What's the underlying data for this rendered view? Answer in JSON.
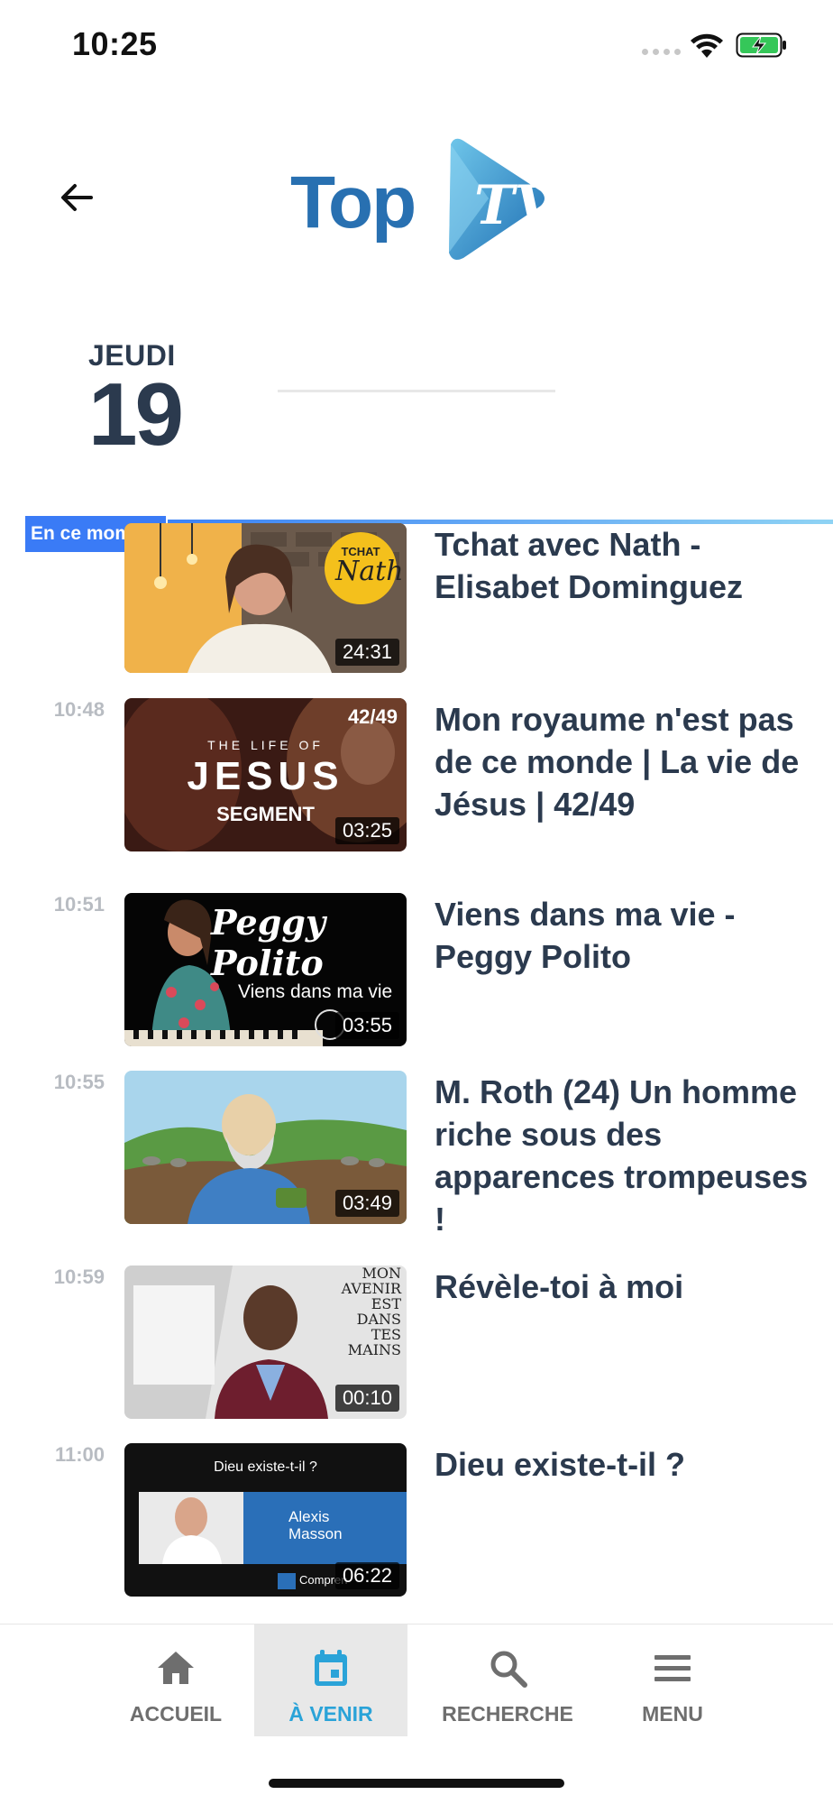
{
  "status_bar": {
    "time": "10:25"
  },
  "header": {
    "logo_text": "Top",
    "logo_mark": "TV"
  },
  "date": {
    "day": "JEUDI",
    "number": "19"
  },
  "now_badge": "En ce moment",
  "items": [
    {
      "time": "",
      "title": "Tchat avec Nath - Elisabet Dominguez",
      "duration": "24:31"
    },
    {
      "time": "10:48",
      "title": "Mon royaume n'est pas de ce monde | La vie de Jésus | 42/49",
      "duration": "03:25",
      "thumb_text": [
        "42/49",
        "THE LIFE OF",
        "JESUS",
        "SEGMENT"
      ]
    },
    {
      "time": "10:51",
      "title": "Viens dans ma vie - Peggy Polito",
      "duration": "03:55",
      "thumb_text": [
        "Peggy Polito",
        "Viens dans ma vie"
      ]
    },
    {
      "time": "10:55",
      "title": "M. Roth (24) Un homme riche sous des apparences trompeuses !",
      "duration": "03:49"
    },
    {
      "time": "10:59",
      "title": "Révèle-toi à moi",
      "duration": "00:10",
      "thumb_text": [
        "MON",
        "AVENIR",
        "EST",
        "DANS",
        "TES",
        "MAINS"
      ]
    },
    {
      "time": "11:00",
      "title": "Dieu existe-t-il ?",
      "duration": "06:22",
      "thumb_text": [
        "Dieu existe-t-il ?",
        "Alexis",
        "Masson",
        "Compren"
      ]
    }
  ],
  "thumb0_text": [
    "TCHAT",
    "Nath"
  ],
  "nav": [
    {
      "label": "ACCUEIL",
      "icon": "home-icon"
    },
    {
      "label": "À VENIR",
      "icon": "calendar-icon",
      "active": true
    },
    {
      "label": "RECHERCHE",
      "icon": "search-icon"
    },
    {
      "label": "MENU",
      "icon": "menu-icon"
    }
  ],
  "colors": {
    "accent": "#2aa3d8",
    "text": "#2b3a4e",
    "badge": "#3a7bf6"
  }
}
